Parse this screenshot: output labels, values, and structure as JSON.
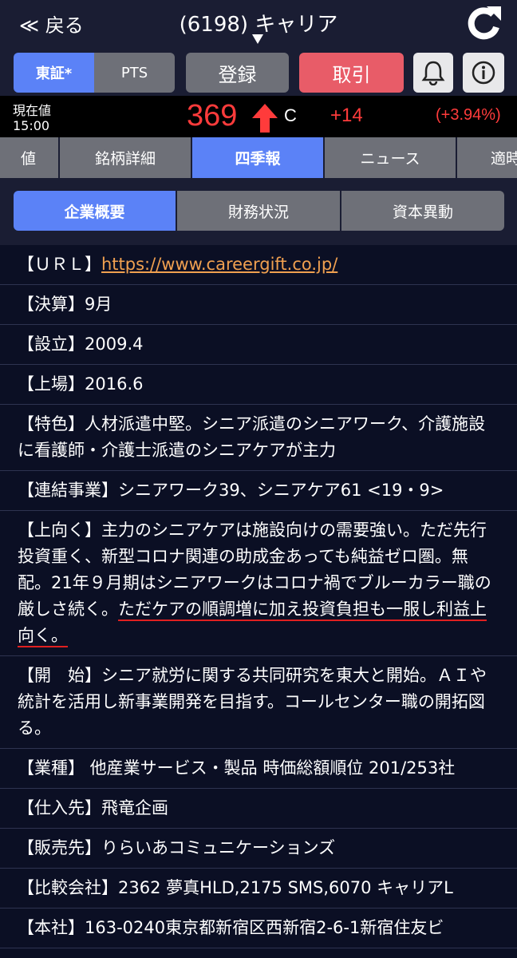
{
  "header": {
    "back_label": "≪ 戻る",
    "title": "(6198) キャリア"
  },
  "toolbar": {
    "market_tokyo": "東証*",
    "market_pts": "PTS",
    "register_label": "登録",
    "trade_label": "取引",
    "bell_icon": "bell-icon",
    "info_icon": "info-icon"
  },
  "quote": {
    "label": "現在値",
    "time": "15:00",
    "price": "369",
    "flag": "C",
    "change": "+14",
    "change_pct": "(+3.94%)",
    "up_color": "#ff3b3b"
  },
  "tabs": [
    "値",
    "銘柄詳細",
    "四季報",
    "ニュース",
    "適時"
  ],
  "active_tab": "四季報",
  "subtabs": [
    "企業概要",
    "財務状況",
    "資本異動"
  ],
  "active_subtab": "企業概要",
  "profile": {
    "url_label": "【ＵＲＬ】",
    "url": "https://www.careergift.co.jp/",
    "settle": "【決算】9月",
    "founded": "【設立】2009.4",
    "listed": "【上場】2016.6",
    "feature": "【特色】人材派遣中堅。シニア派遣のシニアワーク、介護施設に看護師・介護士派遣のシニアケアが主力",
    "segments": "【連結事業】シニアワーク39、シニアケア61 <19・9>",
    "outlook_plain": "【上向く】主力のシニアケアは施設向けの需要強い。ただ先行投資重く、新型コロナ関連の助成金あっても純益ゼロ圏。無配。21年９月期はシニアワークはコロナ禍でブルーカラー職の厳しさ続く。",
    "outlook_underlined": "ただケアの順調増に加え投資負担も一服し利益上向く。",
    "start": "【開　始】シニア就労に関する共同研究を東大と開始。ＡＩや統計を活用し新事業開発を目指す。コールセンター職の開拓図る。",
    "industry": "【業種】 他産業サービス・製品 時価総額順位 201/253社",
    "supplier": "【仕入先】飛竜企画",
    "customer": "【販売先】りらいあコミュニケーションズ",
    "peers": "【比較会社】2362 夢真HLD,2175 SMS,6070 キャリアL",
    "hq": "【本社】163-0240東京都新宿区西新宿2-6-1新宿住友ビ"
  }
}
